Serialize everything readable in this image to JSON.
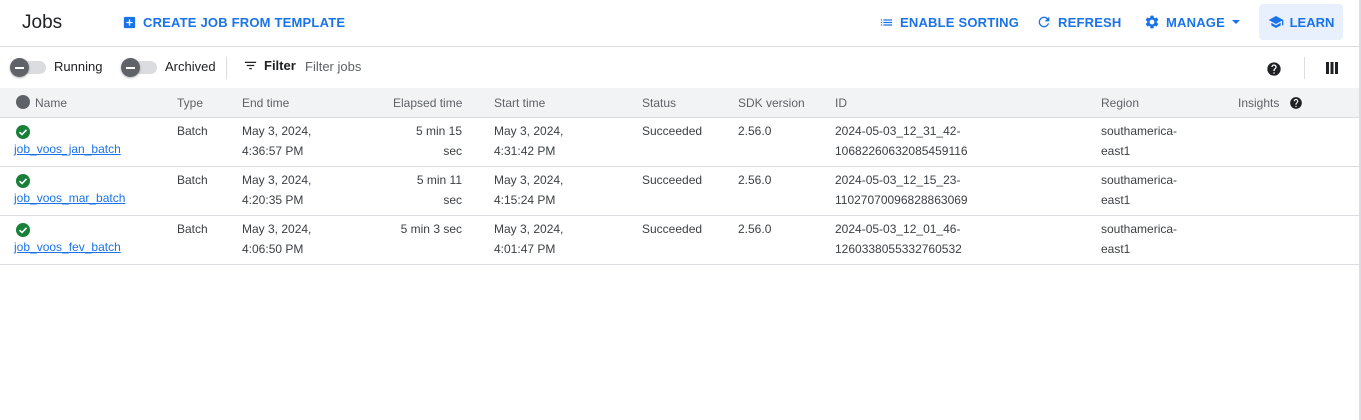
{
  "header": {
    "title": "Jobs",
    "create_job": "CREATE JOB FROM TEMPLATE",
    "enable_sorting": "ENABLE SORTING",
    "refresh": "REFRESH",
    "manage": "MANAGE",
    "learn": "LEARN"
  },
  "filterbar": {
    "running_label": "Running",
    "archived_label": "Archived",
    "filter_label": "Filter",
    "filter_placeholder": "Filter jobs"
  },
  "table": {
    "columns": {
      "name": "Name",
      "type": "Type",
      "end_time": "End time",
      "elapsed": "Elapsed time",
      "start_time": "Start time",
      "status": "Status",
      "sdk": "SDK version",
      "id": "ID",
      "region": "Region",
      "insights": "Insights"
    },
    "rows": [
      {
        "name": "job_voos_jan_batch",
        "type": "Batch",
        "end_time_1": "May 3, 2024,",
        "end_time_2": "4:36:57 PM",
        "elapsed_1": "5 min 15",
        "elapsed_2": "sec",
        "start_time_1": "May 3, 2024,",
        "start_time_2": "4:31:42 PM",
        "status": "Succeeded",
        "sdk": "2.56.0",
        "id_1": "2024-05-03_12_31_42-",
        "id_2": "10682260632085459116",
        "region_1": "southamerica-",
        "region_2": "east1"
      },
      {
        "name": "job_voos_mar_batch",
        "type": "Batch",
        "end_time_1": "May 3, 2024,",
        "end_time_2": "4:20:35 PM",
        "elapsed_1": "5 min 11",
        "elapsed_2": "sec",
        "start_time_1": "May 3, 2024,",
        "start_time_2": "4:15:24 PM",
        "status": "Succeeded",
        "sdk": "2.56.0",
        "id_1": "2024-05-03_12_15_23-",
        "id_2": "11027070096828863069",
        "region_1": "southamerica-",
        "region_2": "east1"
      },
      {
        "name": "job_voos_fev_batch",
        "type": "Batch",
        "end_time_1": "May 3, 2024,",
        "end_time_2": "4:06:50 PM",
        "elapsed_1": "5 min 3 sec",
        "elapsed_2": "",
        "start_time_1": "May 3, 2024,",
        "start_time_2": "4:01:47 PM",
        "status": "Succeeded",
        "sdk": "2.56.0",
        "id_1": "2024-05-03_12_01_46-",
        "id_2": "1260338055332760532",
        "region_1": "southamerica-",
        "region_2": "east1"
      }
    ]
  },
  "icons": {
    "create": "add-box-icon",
    "sort": "list-icon",
    "refresh": "refresh-icon",
    "manage": "gear-icon",
    "learn": "school-icon",
    "filter": "filter-icon",
    "help": "help-icon",
    "columns": "columns-icon",
    "status": "check-circle-icon"
  },
  "colors": {
    "accent": "#1a73e8",
    "success": "#188038",
    "header_bg": "#f1f3f4",
    "learn_bg": "#e8f0fe"
  }
}
